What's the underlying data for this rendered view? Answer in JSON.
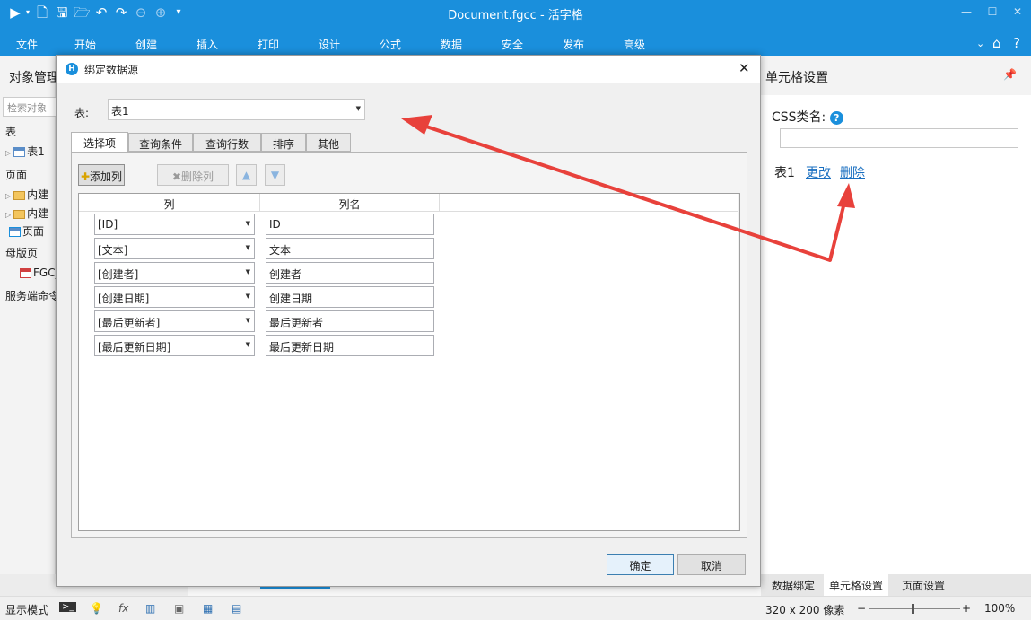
{
  "app": {
    "title": "Document.fgcc - 活字格",
    "ribbon_tabs": [
      "文件",
      "开始",
      "创建",
      "插入",
      "打印",
      "设计",
      "公式",
      "数据",
      "安全",
      "发布",
      "高级"
    ]
  },
  "left_panel": {
    "title": "对象管理",
    "search_placeholder": "检索对象",
    "sections": {
      "tables": "表",
      "pages": "页面",
      "master": "母版页",
      "server": "服务端命令"
    },
    "items": {
      "table1": "表1",
      "builtin1": "内建",
      "builtin2": "内建",
      "page": "页面",
      "fgc": "FGC_"
    }
  },
  "right_panel": {
    "title": "单元格设置",
    "css_label": "CSS类名:",
    "css_value": "",
    "binding_table": "表1",
    "change_link": "更改",
    "delete_link": "删除",
    "bottom_tabs": [
      "数据绑定",
      "单元格设置",
      "页面设置"
    ]
  },
  "statusbar": {
    "mode": "显示模式",
    "size": "320 x 200 像素",
    "zoom": "100%"
  },
  "dialog": {
    "title": "绑定数据源",
    "table_label": "表:",
    "table_value": "表1",
    "tabs": [
      "选择项",
      "查询条件",
      "查询行数",
      "排序",
      "其他"
    ],
    "add_column": "添加列",
    "delete_column": "删除列",
    "grid_headers": [
      "列",
      "列名"
    ],
    "rows": [
      {
        "column": "[ID]",
        "name": "ID"
      },
      {
        "column": "[文本]",
        "name": "文本"
      },
      {
        "column": "[创建者]",
        "name": "创建者"
      },
      {
        "column": "[创建日期]",
        "name": "创建日期"
      },
      {
        "column": "[最后更新者]",
        "name": "最后更新者"
      },
      {
        "column": "[最后更新日期]",
        "name": "最后更新日期"
      }
    ],
    "ok": "确定",
    "cancel": "取消"
  },
  "colors": {
    "accent": "#1a8fdc",
    "arrow": "#e8413b"
  }
}
